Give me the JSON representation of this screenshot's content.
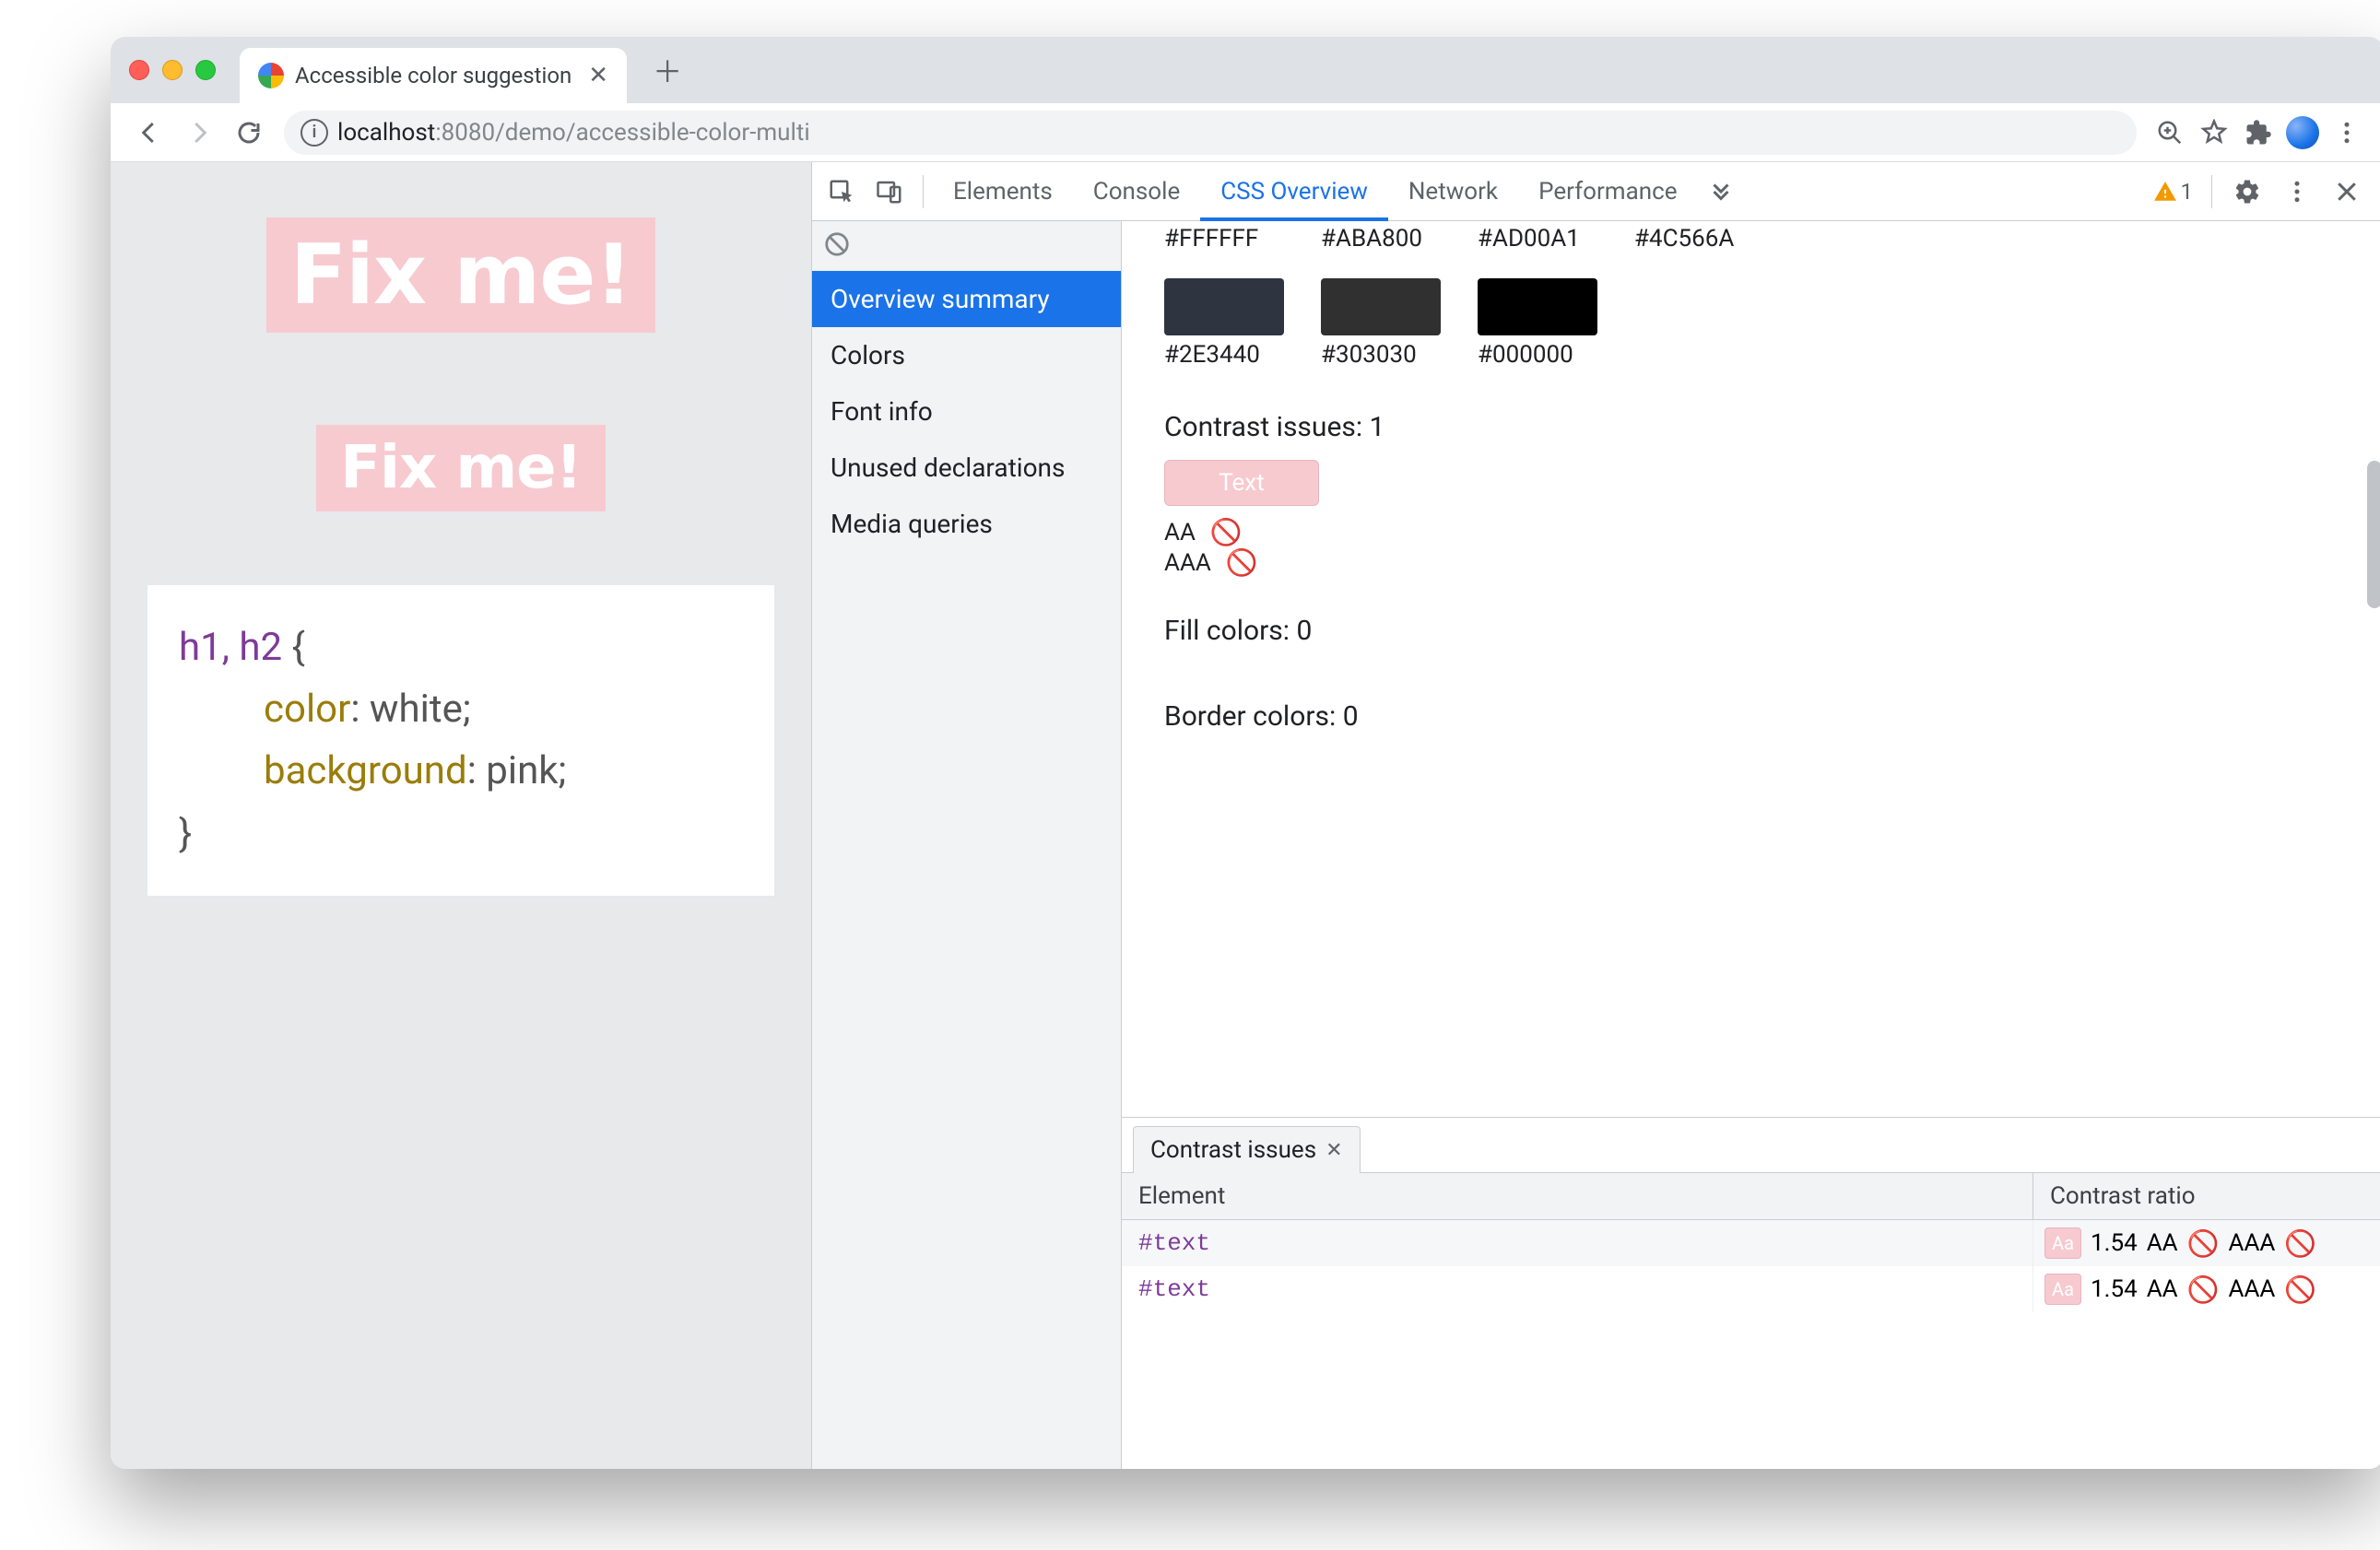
{
  "browser": {
    "tab": {
      "title": "Accessible color suggestion"
    },
    "url": {
      "host": "localhost",
      "port": ":8080",
      "path": "/demo/accessible-color-multi"
    }
  },
  "page": {
    "h1": "Fix me!",
    "h2": "Fix me!",
    "code": {
      "selector": "h1, h2",
      "open": " {",
      "line1_prop": "color",
      "line1_val": ": white;",
      "line2_prop": "background",
      "line2_val": ": pink;",
      "close": "}"
    }
  },
  "devtools": {
    "tabs": {
      "elements": "Elements",
      "console": "Console",
      "css_overview": "CSS Overview",
      "network": "Network",
      "performance": "Performance"
    },
    "warnings": "1",
    "sidebar": {
      "overview": "Overview summary",
      "colors": "Colors",
      "font": "Font info",
      "unused": "Unused declarations",
      "media": "Media queries"
    },
    "swatches_top": {
      "c1": "#FFFFFF",
      "c2": "#ABA800",
      "c3": "#AD00A1",
      "c4": "#4C566A"
    },
    "swatches_mid": {
      "c1": "#2E3440",
      "c2": "#303030",
      "c3": "#000000"
    },
    "contrast_heading": "Contrast issues: 1",
    "contrast_chip": "Text",
    "aa": "AA",
    "aaa": "AAA",
    "fill_heading": "Fill colors: 0",
    "border_heading": "Border colors: 0",
    "bottom": {
      "tab": "Contrast issues",
      "col_element": "Element",
      "col_ratio": "Contrast ratio",
      "rows": [
        {
          "el": "#text",
          "aa_label": "Aa",
          "ratio": "1.54",
          "aa": "AA",
          "aaa": "AAA"
        },
        {
          "el": "#text",
          "aa_label": "Aa",
          "ratio": "1.54",
          "aa": "AA",
          "aaa": "AAA"
        }
      ]
    }
  }
}
